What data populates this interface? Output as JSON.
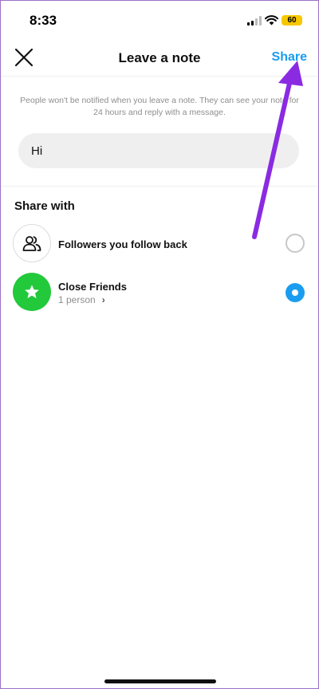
{
  "status_bar": {
    "time": "8:33",
    "battery": "60"
  },
  "header": {
    "title": "Leave a note",
    "share_label": "Share"
  },
  "info_text": "People won't be notified when you leave a note. They can see your note for 24 hours and reply with a message.",
  "note_input": {
    "value": "Hi"
  },
  "share_with": {
    "title": "Share with",
    "options": [
      {
        "label": "Followers you follow back",
        "icon": "people-icon",
        "selected": false
      },
      {
        "label": "Close Friends",
        "sublabel": "1 person",
        "icon": "star-icon",
        "selected": true
      }
    ]
  },
  "colors": {
    "accent": "#1a9df0",
    "close_friends": "#22c93b",
    "annotation_arrow": "#8a2be2"
  }
}
